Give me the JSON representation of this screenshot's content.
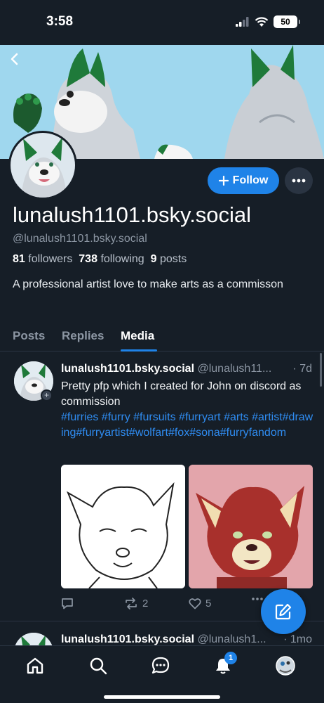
{
  "status_bar": {
    "time": "3:58",
    "battery": "50"
  },
  "profile": {
    "display_name": "lunalush1101.bsky.social",
    "handle": "@lunalush1101.bsky.social",
    "followers_count": "81",
    "followers_label": "followers",
    "following_count": "738",
    "following_label": "following",
    "posts_count": "9",
    "posts_label": "posts",
    "bio": "A professional artist love to make arts as a commisson",
    "follow_label": "Follow"
  },
  "tabs": [
    {
      "label": "Posts"
    },
    {
      "label": "Replies"
    },
    {
      "label": "Media"
    }
  ],
  "posts": [
    {
      "display_name": "lunalush1101.bsky.social",
      "handle": "@lunalush11...",
      "time": "· 7d",
      "text": "Pretty pfp which I created for John on discord as commission",
      "tags": "#furries #furry #fursuits #furryart #arts #artist#drawing#furryartist#wolfart#fox#sona#furryfandom",
      "reposts": "2",
      "likes": "5"
    },
    {
      "display_name": "lunalush1101.bsky.social",
      "handle": "@lunalush1...",
      "time": "· 1mo"
    }
  ],
  "nav": {
    "notification_count": "1"
  },
  "colors": {
    "background": "#161e27",
    "accent": "#1f83e8",
    "link": "#2f8cf1",
    "muted": "#8c96a3"
  },
  "icons": [
    "chevron-left-icon",
    "plus-icon",
    "ellipsis-icon",
    "reply-icon",
    "repost-icon",
    "heart-icon",
    "compose-icon",
    "home-icon",
    "search-icon",
    "chat-icon",
    "bell-icon"
  ]
}
